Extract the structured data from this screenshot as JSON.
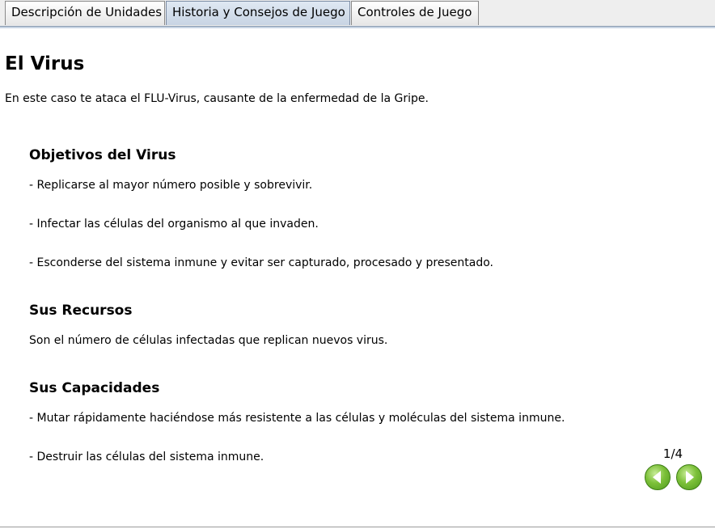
{
  "tabs": [
    {
      "label": "Descripción de Unidades",
      "active": false
    },
    {
      "label": "Historia y Consejos de Juego",
      "active": true
    },
    {
      "label": "Controles de Juego",
      "active": false
    }
  ],
  "page": {
    "title": "El Virus",
    "intro": "En este caso te ataca el FLU-Virus, causante de la enfermedad de la Gripe.",
    "sections": [
      {
        "title": "Objetivos del Virus",
        "lines": [
          "- Replicarse al mayor número posible y sobrevivir.",
          "- Infectar las células del organismo al que invaden.",
          "- Esconderse del sistema inmune y evitar ser capturado, procesado y presentado."
        ]
      },
      {
        "title": "Sus Recursos",
        "lines": [
          "Son el número de células infectadas que replican nuevos virus."
        ]
      },
      {
        "title": "Sus Capacidades",
        "lines": [
          "- Mutar rápidamente haciéndose más resistente a las células y moléculas del sistema inmune.",
          "- Destruir las células del sistema inmune."
        ]
      }
    ]
  },
  "pagination": {
    "indicator": "1/4",
    "prev_icon": "arrow-left-icon",
    "next_icon": "arrow-right-icon",
    "button_color": "#5aa82a"
  }
}
